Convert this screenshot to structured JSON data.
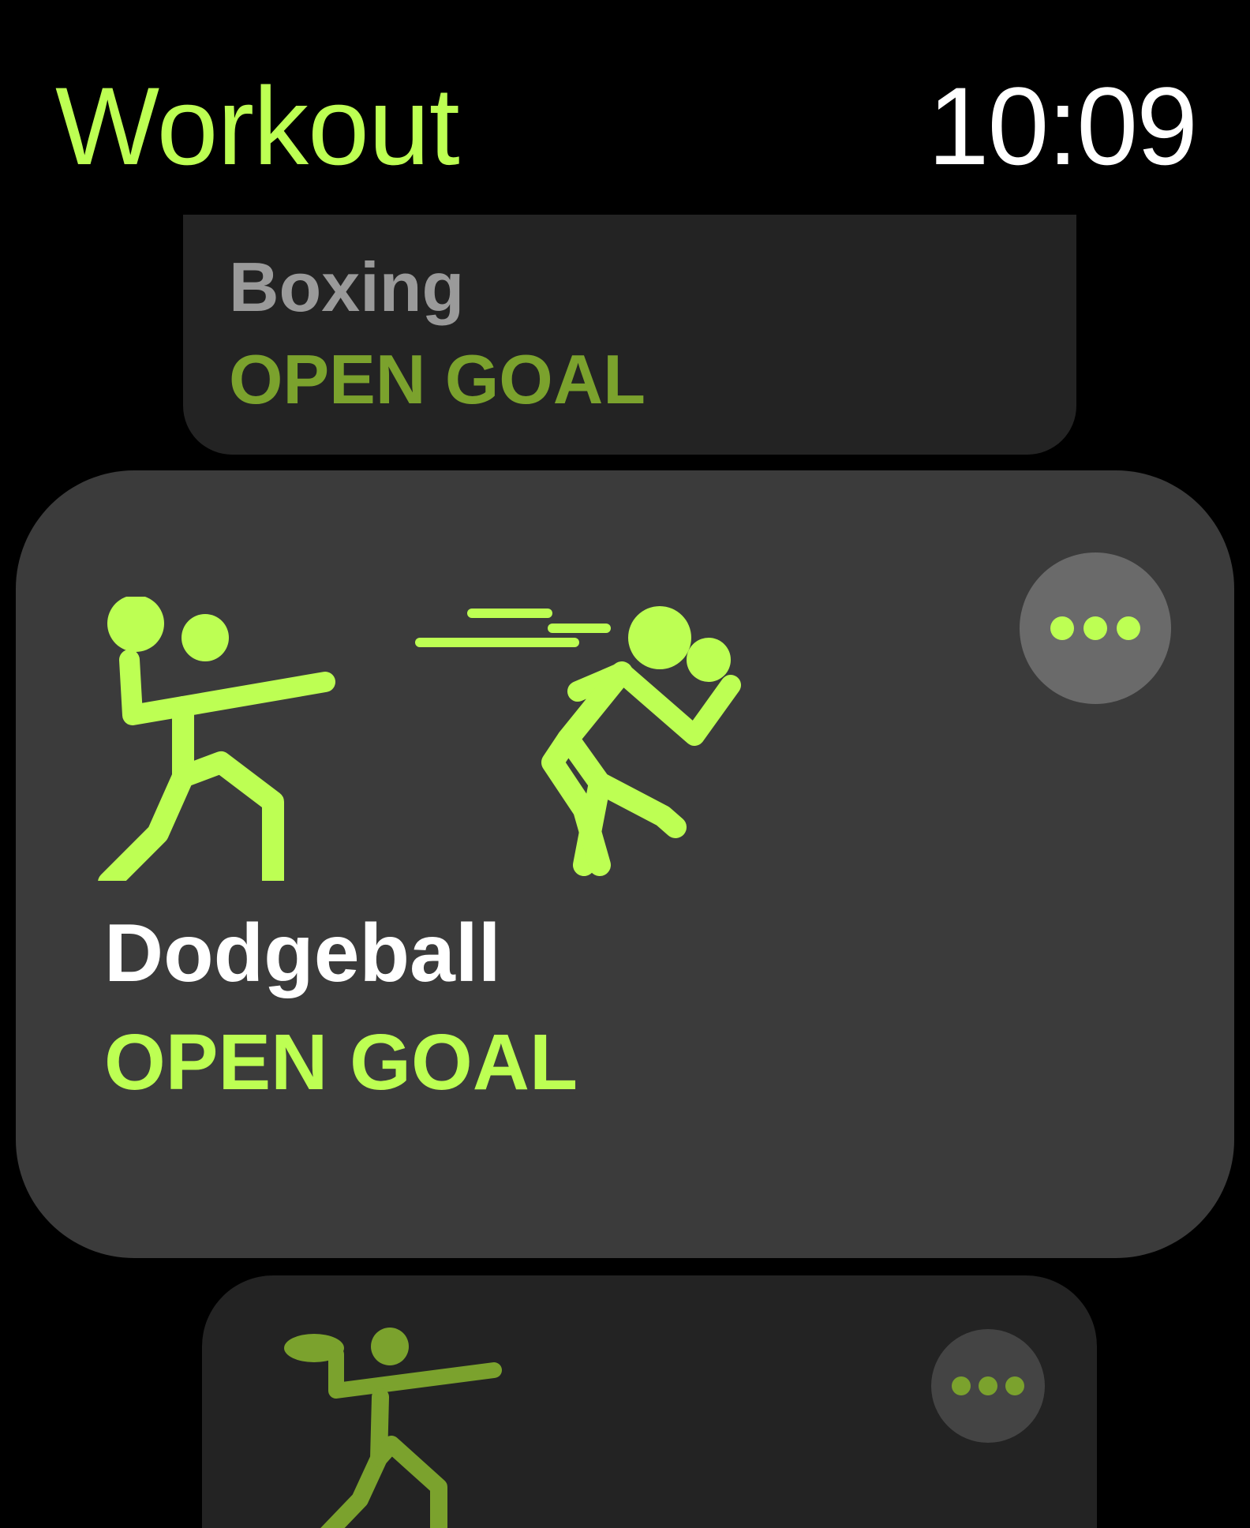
{
  "header": {
    "title": "Workout",
    "time": "10:09"
  },
  "workouts": [
    {
      "name": "Boxing",
      "goal": "OPEN GOAL",
      "state": "previous"
    },
    {
      "name": "Dodgeball",
      "goal": "OPEN GOAL",
      "state": "focused",
      "icon": "dodgeball-icon"
    },
    {
      "name": "",
      "goal": "",
      "state": "next",
      "icon": "american-football-icon"
    }
  ],
  "colors": {
    "accent": "#bdff53",
    "accent_dim": "#7ba22d",
    "card_focused": "#3b3b3b",
    "card_dim": "#232323"
  }
}
